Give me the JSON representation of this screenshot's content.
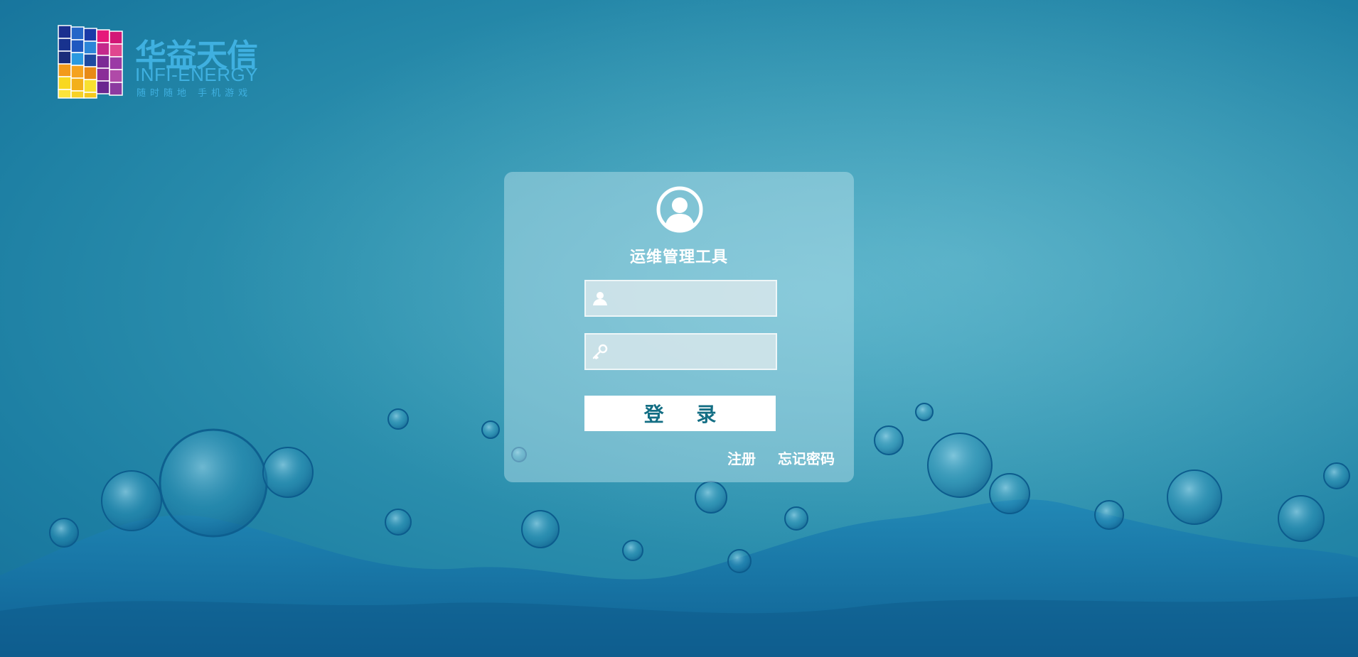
{
  "logo": {
    "name_cn": "华益天信",
    "name_en": "INFI-ENERGY",
    "slogan": "随时随地 手机游戏"
  },
  "login": {
    "title": "运维管理工具",
    "username": {
      "value": "",
      "icon": "user-icon"
    },
    "password": {
      "value": "",
      "icon": "key-icon"
    },
    "submit_label": "登  录",
    "register_label": "注册",
    "forgot_label": "忘记密码"
  },
  "colors": {
    "background": "#2f93b0",
    "accent": "#3fb0e0",
    "button_text": "#136e84",
    "card": "rgba(190,228,238,0.45)"
  }
}
